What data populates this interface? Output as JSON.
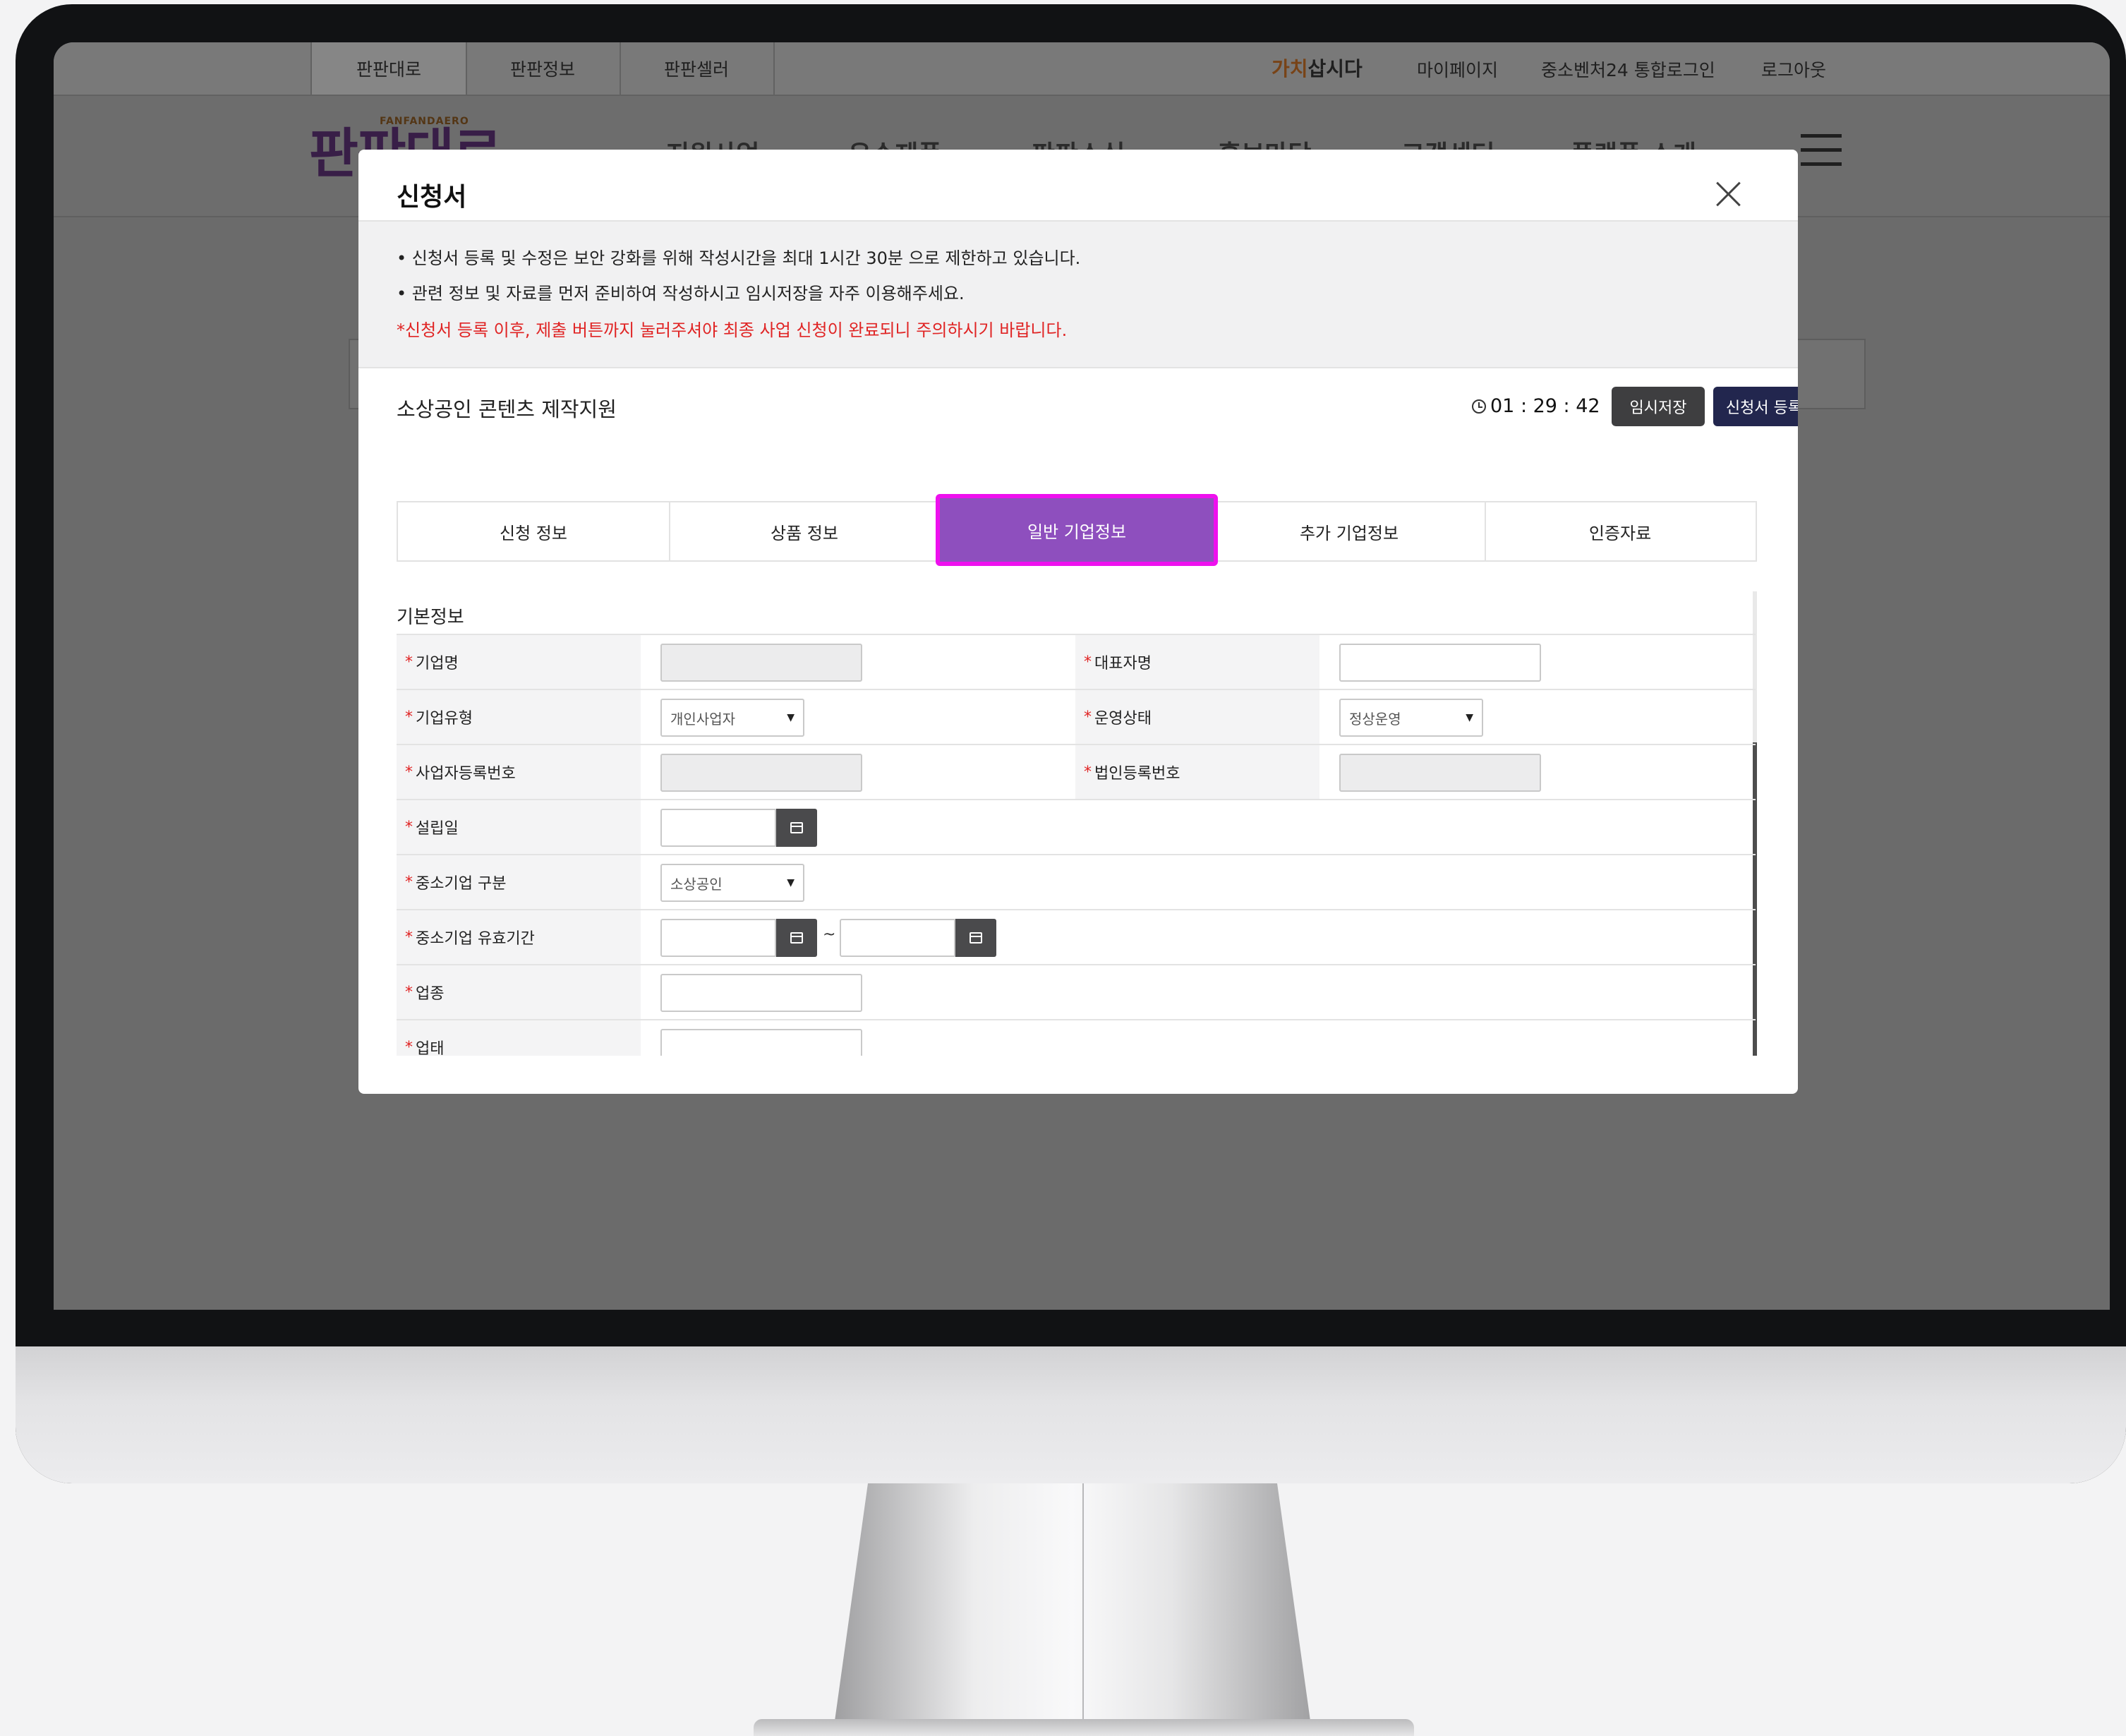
{
  "site": {
    "top_tabs": [
      "판판대로",
      "판판정보",
      "판판셀러"
    ],
    "util": {
      "gachi_a": "가치",
      "gachi_b": "삽시다",
      "mypage": "마이페이지",
      "sso_login": "중소벤처24 통합로그인",
      "logout": "로그아웃"
    },
    "logo_sub": "FANFANDAERO",
    "logo_main": "판판대로",
    "nav": [
      "지원사업",
      "우수제품",
      "판판소식",
      "홍보마당",
      "고객센터",
      "플랫폼 소개"
    ]
  },
  "modal": {
    "title": "신청서",
    "notices": [
      "• 신청서 등록 및 수정은 보안 강화를 위해 작성시간을 최대 1시간 30분 으로 제한하고 있습니다.",
      "• 관련 정보 및 자료를 먼저 준비하여 작성하시고 임시저장을 자주 이용해주세요."
    ],
    "warning": "*신청서 등록 이후, 제출 버튼까지 눌러주셔야 최종 사업 신청이 완료되니 주의하시기 바랍니다.",
    "program_title": "소상공인 콘텐츠 제작지원",
    "timer": "01 : 29 : 42",
    "btn_temp_save": "임시저장",
    "btn_register": "신청서 등록",
    "tabs": [
      "신청 정보",
      "상품 정보",
      "일반 기업정보",
      "추가 기업정보",
      "인증자료"
    ],
    "active_tab": "일반 기업정보",
    "section_title": "기본정보",
    "required_mark": "*",
    "fields": {
      "company_name": "기업명",
      "ceo_name": "대표자명",
      "company_type": "기업유형",
      "company_type_value": "개인사업자",
      "operation_status": "운영상태",
      "operation_status_value": "정상운영",
      "business_reg_no": "사업자등록번호",
      "corp_reg_no": "법인등록번호",
      "established_date": "설립일",
      "sme_category": "중소기업 구분",
      "sme_category_value": "소상공인",
      "sme_valid_period": "중소기업 유효기간",
      "range_sep": "~",
      "industry": "업종",
      "business_type": "업태"
    }
  },
  "colors": {
    "active_tab_bg": "#8e4fbe",
    "highlight_border": "#ee10ee",
    "register_button": "#22264e",
    "temp_save_button": "#3e3e40",
    "required": "#e02424"
  }
}
